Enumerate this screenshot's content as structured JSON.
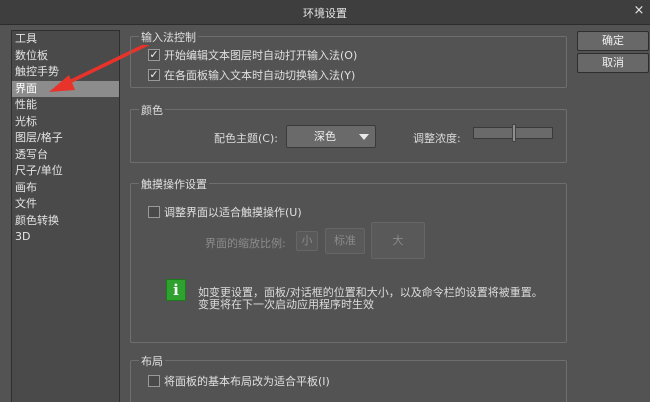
{
  "window": {
    "title": "环境设置",
    "close_glyph": "×"
  },
  "sidebar": {
    "items": [
      {
        "label": "工具"
      },
      {
        "label": "数位板"
      },
      {
        "label": "触控手势"
      },
      {
        "label": "界面",
        "selected": true
      },
      {
        "label": "性能"
      },
      {
        "label": "光标"
      },
      {
        "label": "图层/格子"
      },
      {
        "label": "透写台"
      },
      {
        "label": "尺子/单位"
      },
      {
        "label": "画布"
      },
      {
        "label": "文件"
      },
      {
        "label": "颜色转换"
      },
      {
        "label": "3D"
      }
    ]
  },
  "buttons": {
    "ok": "确定",
    "cancel": "取消"
  },
  "ime": {
    "legend": "输入法控制",
    "option1": {
      "label": "开始编辑文本图层时自动打开输入法(O)",
      "checked": true
    },
    "option2": {
      "label": "在各面板输入文本时自动切换输入法(Y)",
      "checked": true
    }
  },
  "color": {
    "legend": "颜色",
    "theme_label": "配色主题(C):",
    "theme_value": "深色",
    "density_label": "调整浓度:"
  },
  "touch": {
    "legend": "触摸操作设置",
    "adjust": {
      "label": "调整界面以适合触摸操作(U)",
      "checked": false
    },
    "scale_label": "界面的缩放比例:",
    "sizes": [
      "小",
      "标准",
      "大"
    ],
    "info_line1": "如变更设置，面板/对话框的位置和大小，以及命令栏的设置将被重置。",
    "info_line2": "变更将在下一次启动应用程序时生效"
  },
  "layout": {
    "legend": "布局",
    "tablet": {
      "label": "将面板的基本布局改为适合平板(I)",
      "checked": false
    }
  },
  "colors": {
    "annotation_arrow": "#e8332a",
    "info_icon": "#2fa12f",
    "selected_item": "#8c8c8c"
  },
  "icons": {
    "check": "checkmark-icon",
    "info": "info-icon",
    "close": "close-icon",
    "dropdown": "chevron-down-icon"
  }
}
